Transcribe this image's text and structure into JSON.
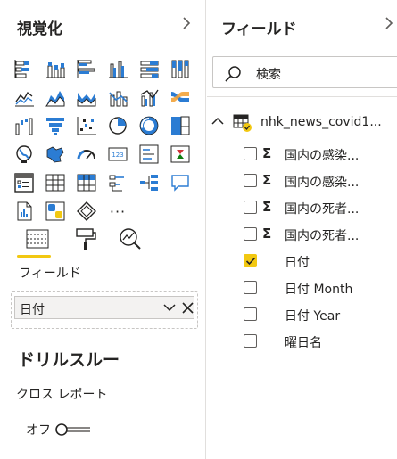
{
  "visualizations": {
    "title": "視覚化",
    "collapse_icon": "chevron-right-icon",
    "icons": [
      "stacked-bar-chart-icon",
      "stacked-column-chart-icon",
      "clustered-bar-chart-icon",
      "clustered-column-chart-icon",
      "100-percent-stacked-bar-chart-icon",
      "100-percent-stacked-column-chart-icon",
      "line-chart-icon",
      "area-chart-icon",
      "stacked-area-chart-icon",
      "line-and-stacked-column-chart-icon",
      "line-and-clustered-column-chart-icon",
      "ribbon-chart-icon",
      "waterfall-chart-icon",
      "funnel-chart-icon",
      "scatter-chart-icon",
      "pie-chart-icon",
      "donut-chart-icon",
      "treemap-icon",
      "map-icon",
      "filled-map-icon",
      "gauge-icon",
      "card-icon",
      "multi-row-card-icon",
      "kpi-icon",
      "slicer-icon",
      "table-icon",
      "matrix-icon",
      "key-influencers-icon",
      "decomposition-tree-icon",
      "qa-icon",
      "paginated-report-icon",
      "python-visual-icon",
      "power-apps-icon",
      "more-visuals-icon"
    ],
    "more_label": "···",
    "tabs": [
      "fields-tab-icon",
      "format-tab-icon",
      "analytics-tab-icon"
    ],
    "field_section_label": "フィールド",
    "field_well": {
      "value": "日付",
      "expand_icon": "chevron-down-icon",
      "remove_icon": "close-icon"
    },
    "drillthrough_title": "ドリルスルー",
    "cross_report_label": "クロス レポート",
    "toggle_label": "オフ",
    "toggle_on": false
  },
  "fields": {
    "title": "フィールド",
    "collapse_icon": "chevron-right-icon",
    "search_placeholder": "検索",
    "table_name": "nhk_news_covid1...",
    "items": [
      {
        "label": "国内の感染...",
        "checked": false,
        "sigma": true
      },
      {
        "label": "国内の感染...",
        "checked": false,
        "sigma": true
      },
      {
        "label": "国内の死者...",
        "checked": false,
        "sigma": true
      },
      {
        "label": "国内の死者...",
        "checked": false,
        "sigma": true
      },
      {
        "label": "日付",
        "checked": true,
        "sigma": false
      },
      {
        "label": "日付 Month",
        "checked": false,
        "sigma": false
      },
      {
        "label": "日付 Year",
        "checked": false,
        "sigma": false
      },
      {
        "label": "曜日名",
        "checked": false,
        "sigma": false
      }
    ],
    "sigma_symbol": "Σ"
  },
  "colors": {
    "accent_yellow": "#f2c811",
    "icon_blue": "#2b7cd3",
    "text": "#252423",
    "border": "#e1dfdd"
  }
}
